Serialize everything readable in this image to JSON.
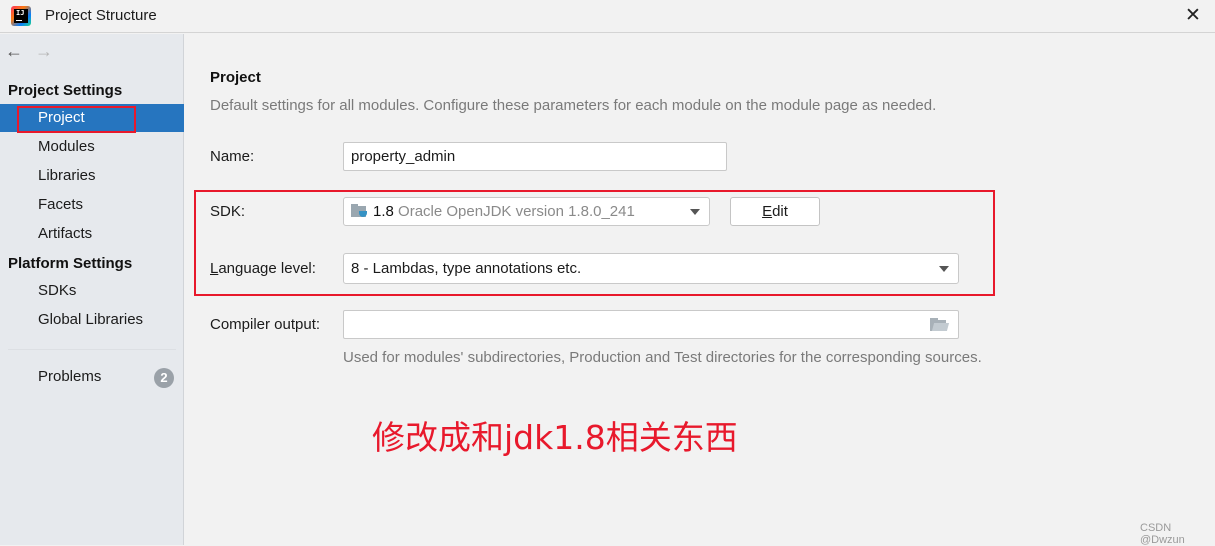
{
  "window": {
    "title": "Project Structure",
    "app_icon": "intellij-idea-icon",
    "app_icon_text": "IJ",
    "close_icon": "close-icon",
    "close_glyph": "✕"
  },
  "sidebar": {
    "nav": {
      "back_glyph": "🡐",
      "forward_glyph": "🡒"
    },
    "sections": [
      {
        "heading": "Project Settings",
        "items": [
          {
            "label": "Project",
            "selected": true
          },
          {
            "label": "Modules"
          },
          {
            "label": "Libraries"
          },
          {
            "label": "Facets"
          },
          {
            "label": "Artifacts"
          }
        ]
      },
      {
        "heading": "Platform Settings",
        "items": [
          {
            "label": "SDKs"
          },
          {
            "label": "Global Libraries"
          }
        ]
      }
    ],
    "problems": {
      "label": "Problems",
      "count": "2"
    }
  },
  "main": {
    "title": "Project",
    "description": "Default settings for all modules. Configure these parameters for each module on the module page as needed.",
    "name": {
      "label": "Name:",
      "value": "property_admin"
    },
    "sdk": {
      "label": "SDK:",
      "version": "1.8",
      "description": "Oracle OpenJDK version 1.8.0_241",
      "edit_label": "Edit",
      "edit_mnemonic": "E",
      "edit_rest": "dit"
    },
    "language_level": {
      "label_mnemonic": "L",
      "label_rest": "anguage level:",
      "value": "8 - Lambdas, type annotations etc."
    },
    "compiler_output": {
      "label": "Compiler output:",
      "value": "",
      "hint": "Used for modules' subdirectories, Production and Test directories for the corresponding sources."
    },
    "annotation": "修改成和jdk1.8相关东西"
  },
  "watermark": "CSDN @Dwzun",
  "colors": {
    "selection": "#2675bf",
    "annotation_red": "#e8192c",
    "sidebar_bg": "#e6e9ed",
    "content_bg": "#f2f2f2"
  }
}
